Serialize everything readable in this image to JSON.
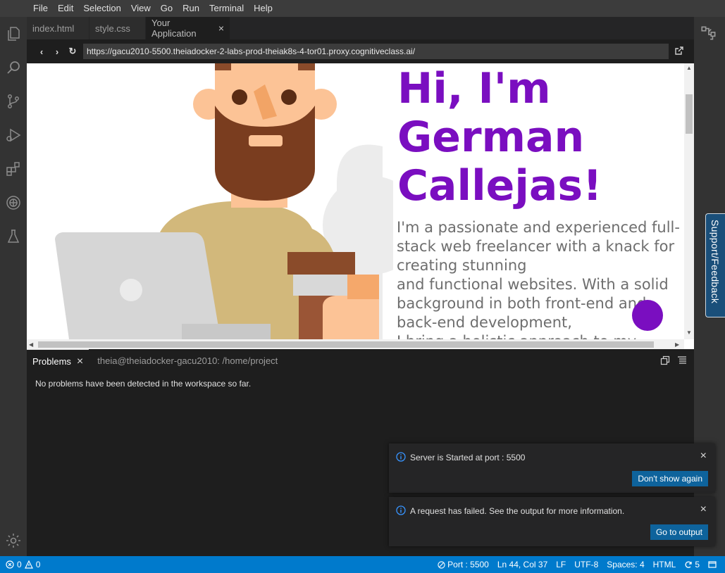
{
  "menu": [
    "File",
    "Edit",
    "Selection",
    "View",
    "Go",
    "Run",
    "Terminal",
    "Help"
  ],
  "tabs": [
    {
      "label": "index.html"
    },
    {
      "label": "style.css"
    },
    {
      "label": "Your Application",
      "close": "×"
    }
  ],
  "browser": {
    "url": "https://gacu2010-5500.theiadocker-2-labs-prod-theiak8s-4-tor01.proxy.cognitiveclass.ai/",
    "back": "‹",
    "forward": "›",
    "reload": "↻"
  },
  "page": {
    "title_lines": [
      "Hi, I'm",
      "German",
      "Callejas!"
    ],
    "intro_lines": [
      "I'm a passionate and experienced full-",
      "stack web freelancer with a knack for",
      "creating stunning",
      "and functional websites. With a solid",
      "background in both front-end and",
      "back-end development,",
      "I bring a holistic approach to my"
    ],
    "accent_color": "#7a0ec0"
  },
  "panel": {
    "tab_problems": "Problems",
    "tab_close": "×",
    "tab_terminal": "theia@theiadocker-gacu2010: /home/project",
    "message": "No problems have been detected in the workspace so far."
  },
  "notifications": [
    {
      "message": "Server is Started at port : 5500",
      "button": "Don't show again",
      "close": "×"
    },
    {
      "message": "A request has failed. See the output for more information.",
      "button": "Go to output",
      "close": "×"
    }
  ],
  "support": "Support/Feedback",
  "status": {
    "errors": "0",
    "warnings": "0",
    "port": "Port : 5500",
    "position": "Ln 44, Col 37",
    "eol": "LF",
    "encoding": "UTF-8",
    "indent": "Spaces: 4",
    "language": "HTML",
    "sync_count": "5"
  }
}
